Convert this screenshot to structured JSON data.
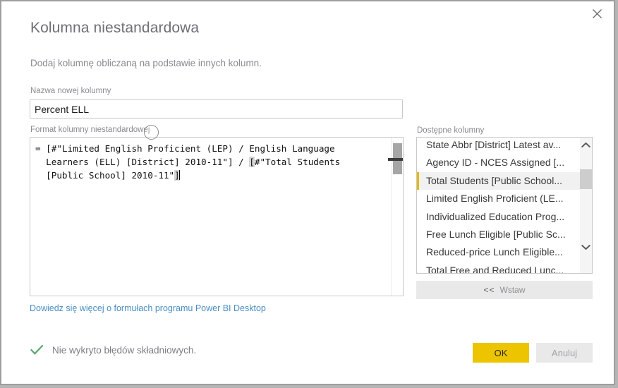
{
  "dialog": {
    "title": "Kolumna niestandardowa",
    "subtitle": "Dodaj kolumnę obliczaną na podstawie innych kolumn.",
    "close_icon": "close-icon"
  },
  "name_field": {
    "label": "Nazwa nowej kolumny",
    "value": "Percent ELL",
    "placeholder": ""
  },
  "formula_field": {
    "label": "Format kolumny niestandardowej",
    "value": "= [#\"Limited English Proficient (LEP) / English Language\n  Learners (ELL) [District] 2010-11\"] / [#\"Total Students\n  [Public School] 2010-11\"]",
    "segments": [
      {
        "text": "= [#\"Limited English Proficient (LEP) / English Language\n  Learners (ELL) [District] 2010-11\"] / ",
        "highlight": false
      },
      {
        "text": "[",
        "highlight": true
      },
      {
        "text": "#\"Total Students\n  [Public School] 2010-11\"",
        "highlight": false
      },
      {
        "text": "]",
        "highlight": true
      }
    ],
    "scrollbar": {
      "thumb_position": "top"
    }
  },
  "help_link": {
    "text": "Dowiedz się więcej o formułach programu Power BI Desktop"
  },
  "status": {
    "icon": "checkmark-icon",
    "text": "Nie wykryto błędów składniowych.",
    "icon_color": "#5fa873"
  },
  "available_columns": {
    "label": "Dostępne kolumny",
    "selected_index": 2,
    "items": [
      "State Abbr [District] Latest av...",
      "Agency ID - NCES Assigned [...",
      "Total Students [Public School...",
      "Limited English Proficient (LE...",
      "Individualized Education Prog...",
      "Free Lunch Eligible [Public Sc...",
      "Reduced-price Lunch Eligible...",
      "Total Free and Reduced Lunc..."
    ],
    "scroll_up_icon": "chevron-up-icon",
    "scroll_down_icon": "chevron-down-icon"
  },
  "insert_button": {
    "chevrons": "<<",
    "label": "Wstaw"
  },
  "footer": {
    "ok_label": "OK",
    "cancel_label": "Anuluj"
  },
  "colors": {
    "accent_yellow": "#ecc400",
    "selection_marker": "#e8b900",
    "link_blue": "#4a8ec2",
    "success_green": "#5fa873",
    "border_gray": "#c8c8c8",
    "page_backdrop": "#b5b5b5"
  }
}
